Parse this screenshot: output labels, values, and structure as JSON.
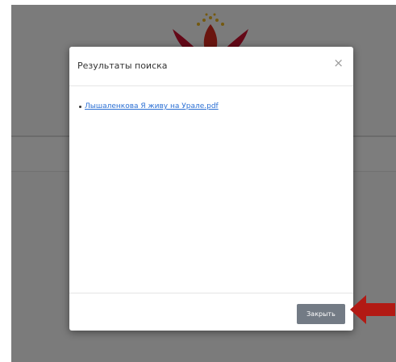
{
  "modal": {
    "title": "Результаты поиска",
    "close_symbol": "×",
    "results": [
      {
        "label": "Лышаленкова Я живу на Урале.pdf"
      }
    ],
    "close_button_label": "Закрыть"
  },
  "icons": {
    "logo": "floral-emblem-icon",
    "annotation": "red-arrow-icon"
  },
  "colors": {
    "overlay": "#000000",
    "link": "#2a6fd4",
    "button": "#737b85",
    "arrow": "#b21a14",
    "logo_red": "#c8102e",
    "logo_gold": "#e8b21e"
  }
}
